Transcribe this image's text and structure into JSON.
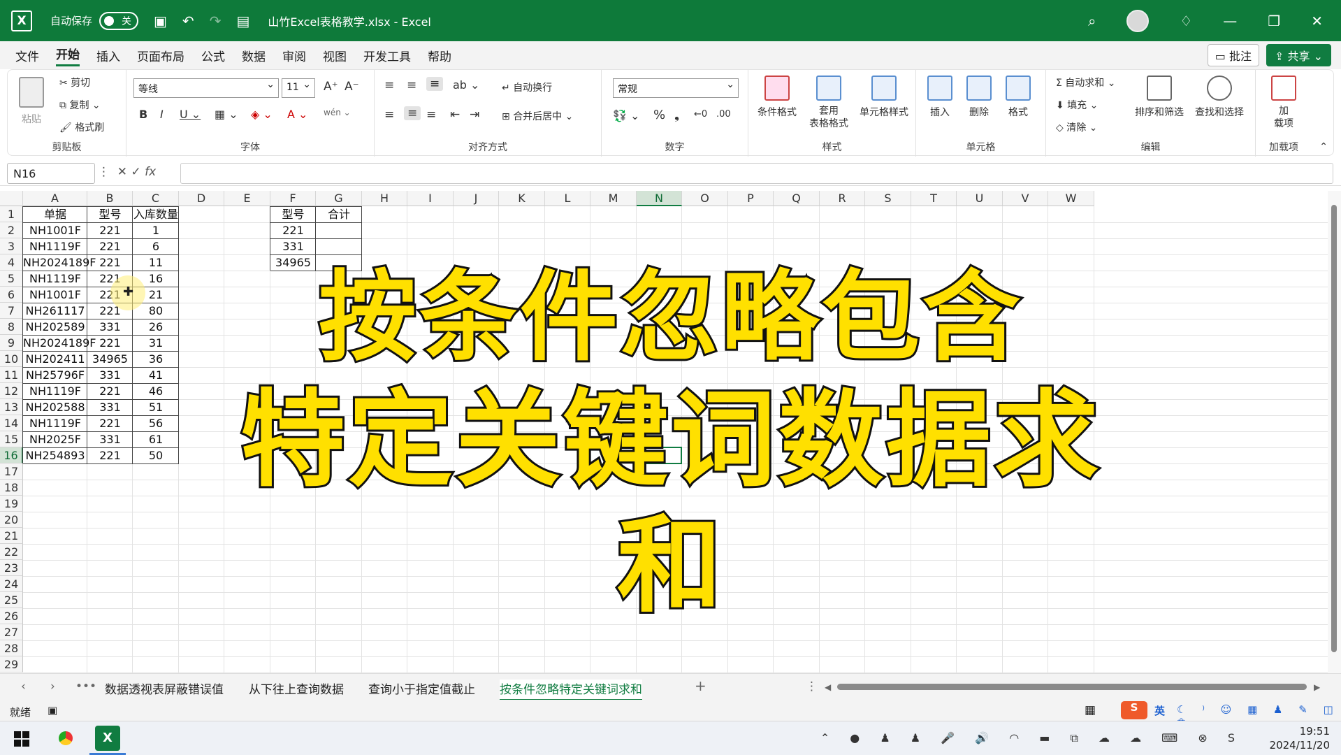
{
  "titlebar": {
    "logo": "X",
    "autosave_label": "自动保存",
    "toggle_state": "关",
    "document_title": "山竹Excel表格教学.xlsx - Excel"
  },
  "menu": {
    "tabs": [
      "文件",
      "开始",
      "插入",
      "页面布局",
      "公式",
      "数据",
      "审阅",
      "视图",
      "开发工具",
      "帮助"
    ],
    "active_tab": "开始",
    "comment_button": "批注",
    "share_button": "共享"
  },
  "ribbon": {
    "clipboard": {
      "title": "剪贴板",
      "paste": "粘贴",
      "cut": "剪切",
      "copy": "复制",
      "format_painter": "格式刷"
    },
    "font": {
      "title": "字体",
      "font_name": "等线",
      "font_size": "11"
    },
    "alignment": {
      "title": "对齐方式",
      "wrap": "自动换行",
      "merge": "合并后居中"
    },
    "number": {
      "title": "数字",
      "format": "常规"
    },
    "styles": {
      "title": "样式",
      "conditional": "条件格式",
      "table_1": "套用",
      "table_2": "表格格式",
      "cell_styles": "单元格样式"
    },
    "cells": {
      "title": "单元格",
      "insert": "插入",
      "delete": "删除",
      "format": "格式"
    },
    "editing": {
      "title": "编辑",
      "autosum": "自动求和",
      "fill": "填充",
      "clear": "清除",
      "sort": "排序和筛选",
      "find": "查找和选择"
    },
    "addins": {
      "title": "加载项",
      "label_1": "加",
      "label_2": "载项"
    }
  },
  "formula_bar": {
    "name_box": "N16",
    "fx": "fx",
    "content": ""
  },
  "columns": [
    "A",
    "B",
    "C",
    "D",
    "E",
    "F",
    "G",
    "H",
    "I",
    "J",
    "K",
    "L",
    "M",
    "N",
    "O",
    "P",
    "Q",
    "R",
    "S",
    "T",
    "U",
    "V",
    "W"
  ],
  "rows_count": 29,
  "selected_cell": {
    "col": "N",
    "row": 16
  },
  "table1": {
    "headers": [
      "单据",
      "型号",
      "入库数量"
    ],
    "rows": [
      [
        "NH1001F",
        "221",
        "1"
      ],
      [
        "NH1119F",
        "221",
        "6"
      ],
      [
        "NH2024189F",
        "221",
        "11"
      ],
      [
        "NH1119F",
        "221",
        "16"
      ],
      [
        "NH1001F",
        "221",
        "21"
      ],
      [
        "NH261117",
        "221",
        "80"
      ],
      [
        "NH202589",
        "331",
        "26"
      ],
      [
        "NH2024189F",
        "221",
        "31"
      ],
      [
        "NH202411",
        "34965",
        "36"
      ],
      [
        "NH25796F",
        "331",
        "41"
      ],
      [
        "NH1119F",
        "221",
        "46"
      ],
      [
        "NH202588",
        "331",
        "51"
      ],
      [
        "NH1119F",
        "221",
        "56"
      ],
      [
        "NH2025F",
        "331",
        "61"
      ],
      [
        "NH254893",
        "221",
        "50"
      ]
    ]
  },
  "table2": {
    "headers": [
      "型号",
      "合计"
    ],
    "rows": [
      [
        "221",
        ""
      ],
      [
        "331",
        ""
      ],
      [
        "34965",
        ""
      ]
    ]
  },
  "overlay": {
    "line1": "按条件忽略包含",
    "line2": "特定关键词数据求和"
  },
  "sheet_tabs": [
    "数据透视表屏蔽错误值",
    "从下往上查询数据",
    "查询小于指定值截止",
    "按条件忽略特定关键词求和"
  ],
  "active_sheet": "按条件忽略特定关键词求和",
  "status": {
    "ready": "就绪"
  },
  "taskbar": {
    "time": "19:51",
    "date": "2024/11/20",
    "ime": "英"
  }
}
